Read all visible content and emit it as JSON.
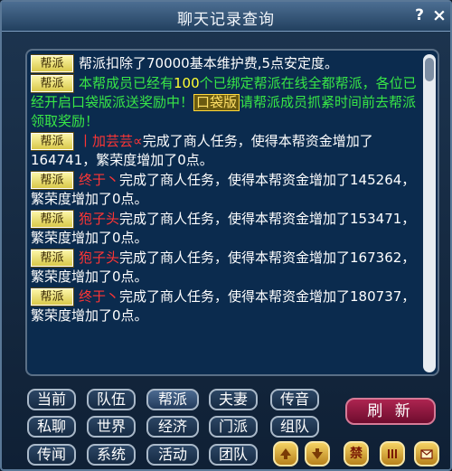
{
  "window": {
    "title": "聊天记录查询",
    "help_label": "?",
    "close_label": "×"
  },
  "tag_label": "帮派",
  "messages": [
    {
      "text": "帮派扣除了70000基本维护费,5点安定度。"
    },
    {
      "pre": "本帮成员已经有",
      "highlight": "100",
      "mid": "个已绑定帮派在线全都",
      "post": "帮派，各位已经开启口袋版派送奖励中！",
      "kouban": "口袋版",
      "tail": "请帮派成员抓紧时间前去帮派领取奖励！"
    },
    {
      "player": "丨加芸芸∝",
      "text": "完成了商人任务，使得本帮资金增加了164741，繁荣度增加了0点。"
    },
    {
      "player": "终于丶",
      "text": "完成了商人任务，使得本帮资金增加了145264，繁荣度增加了0点。"
    },
    {
      "player": "狍子头",
      "text": "完成了商人任务，使得本帮资金增加了153471，繁荣度增加了0点。"
    },
    {
      "player": "狍子头",
      "text": "完成了商人任务，使得本帮资金增加了167362，繁荣度增加了0点。"
    },
    {
      "player": "终于丶",
      "text": "完成了商人任务，使得本帮资金增加了180737，繁荣度增加了0点。"
    }
  ],
  "channels": {
    "row1": [
      "当前",
      "队伍",
      "帮派",
      "夫妻",
      "传音"
    ],
    "row2": [
      "私聊",
      "世界",
      "经济",
      "门派",
      "组队"
    ],
    "row3": [
      "传闻",
      "系统",
      "活动",
      "团队"
    ],
    "active": "帮派"
  },
  "refresh_label": "刷 新",
  "icon_buttons": [
    {
      "name": "gold-up-arrow-icon"
    },
    {
      "name": "gold-down-arrow-icon"
    },
    {
      "name": "ban-icon",
      "label": "禁"
    },
    {
      "name": "bars-icon"
    },
    {
      "name": "mail-icon"
    }
  ],
  "colors": {
    "tag_bg": "#f0e27a",
    "player_name": "#ff3535",
    "system_text": "#ffffff",
    "green_text": "#38e646",
    "refresh_bg": "#9a1a44"
  }
}
